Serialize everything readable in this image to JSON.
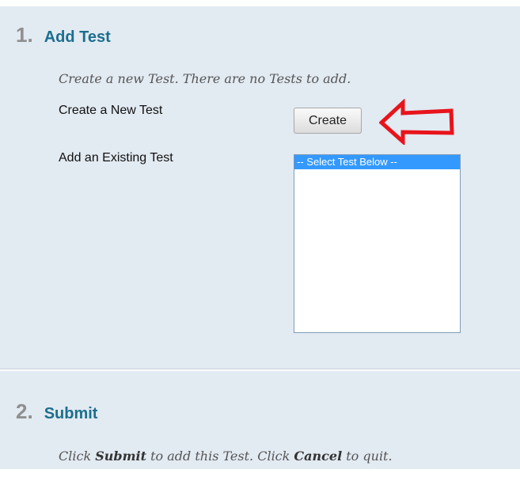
{
  "steps": [
    {
      "number": "1.",
      "title": "Add Test",
      "instructions": "Create a new Test. There are no Tests to add.",
      "create_label": "Create a New Test",
      "create_button": "Create",
      "existing_label": "Add an Existing Test",
      "select_options": [
        "-- Select Test Below --"
      ],
      "selected_option": "-- Select Test Below --"
    },
    {
      "number": "2.",
      "title": "Submit",
      "instructions": {
        "part1": "Click ",
        "submit": "Submit",
        "part2": " to add this Test. Click ",
        "cancel": "Cancel",
        "part3": " to quit."
      }
    }
  ],
  "colors": {
    "panel_background": "#e2eaf2",
    "step_title": "#1c6e8e",
    "step_number": "#8f8f8f",
    "selected_option": "#3399ff",
    "annotation_arrow": "#e8141b"
  }
}
